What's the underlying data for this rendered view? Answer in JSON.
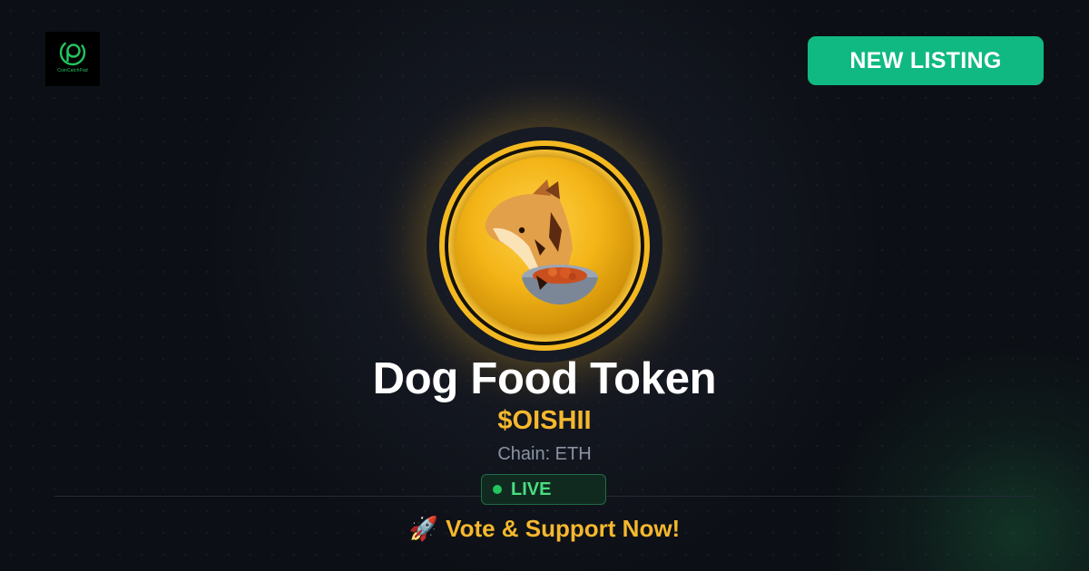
{
  "brand": {
    "logo_text": "CoinCatchPad",
    "logo_icon": "coin-c-icon",
    "accent": "#22c55e"
  },
  "header": {
    "badge_label": "NEW LISTING",
    "badge_color": "#10b981"
  },
  "token": {
    "image_icon": "dog-food-coin-icon",
    "name": "Dog Food Token",
    "symbol": "$OISHII",
    "chain": "Chain: ETH",
    "status": "LIVE",
    "status_color": "#22c55e",
    "symbol_color": "#f5b82e"
  },
  "cta": {
    "icon": "rocket-icon",
    "emoji": "🚀",
    "label": "Vote & Support Now!"
  }
}
